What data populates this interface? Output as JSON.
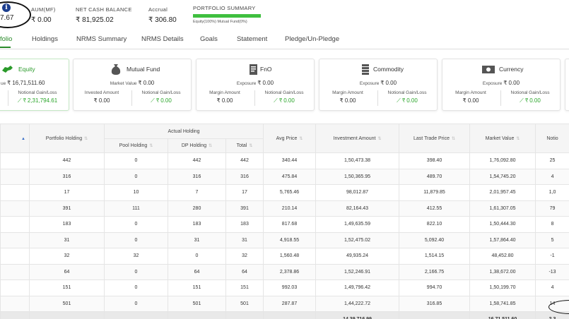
{
  "summary": {
    "aum_total": "7.67",
    "aum_mf_label": "AUM(MF)",
    "aum_mf_value": "₹ 0.00",
    "net_cash_label": "NET CASH BALANCE",
    "net_cash_value": "₹ 81,925.02",
    "accrual_label": "Accrual",
    "accrual_value": "₹ 306.80",
    "portfolio_summary_label": "PORTFOLIO SUMMARY",
    "portfolio_legend": "Equity(100%)   Mutual Fund(0%)",
    "equity_share_percent": 100,
    "accent_color": "#3fbf3f"
  },
  "tabs": [
    {
      "label": "folio"
    },
    {
      "label": "Holdings"
    },
    {
      "label": "NRMS Summary"
    },
    {
      "label": "NRMS Details"
    },
    {
      "label": "Goals"
    },
    {
      "label": "Statement"
    },
    {
      "label": "Pledge/Un-Pledge"
    }
  ],
  "cards": {
    "equity": {
      "title": "Equity",
      "sub_label": "ue",
      "sub_value": "₹ 16,71,511.60",
      "notional_label": "Notional Gain/Loss",
      "notional_value": "₹ 2,31,794.61"
    },
    "mutual_fund": {
      "title": "Mutual Fund",
      "sub_label": "Market Value",
      "sub_value": "₹ 0.00",
      "left_label": "Invested Amount",
      "left_value": "₹ 0.00",
      "right_label": "Notional Gain/Loss",
      "right_value": "₹ 0.00"
    },
    "fno": {
      "title": "FnO",
      "sub_label": "Exposure",
      "sub_value": "₹ 0.00",
      "left_label": "Margin Amount",
      "left_value": "₹ 0.00",
      "right_label": "Notional Gain/Loss",
      "right_value": "₹ 0.00"
    },
    "commodity": {
      "title": "Commodity",
      "sub_label": "Exposure",
      "sub_value": "₹ 0.00",
      "left_label": "Margin Amount",
      "left_value": "₹ 0.00",
      "right_label": "Notional Gain/Loss",
      "right_value": "₹ 0.00"
    },
    "currency": {
      "title": "Currency",
      "sub_label": "Exposure",
      "sub_value": "₹ 0.00",
      "left_label": "Margin Amount",
      "left_value": "₹ 0.00",
      "right_label": "Notional Gain/Loss",
      "right_value": "₹ 0.00"
    }
  },
  "table": {
    "headers": {
      "portfolio_holding": "Portfolio Holding",
      "actual_holding": "Actual Holding",
      "pool_holding": "Pool Holding",
      "dp_holding": "DP Holding",
      "total": "Total",
      "avg_price": "Avg Price",
      "investment_amount": "Investment Amount",
      "last_trade_price": "Last Trade Price",
      "market_value": "Market Value",
      "notional": "Notio"
    },
    "rows": [
      {
        "portfolio": "442",
        "pool": "0",
        "dp": "442",
        "total": "442",
        "avg": "340.44",
        "invest": "1,50,473.38",
        "ltp": "398.40",
        "mv": "1,76,092.80",
        "notional": "25"
      },
      {
        "portfolio": "316",
        "pool": "0",
        "dp": "316",
        "total": "316",
        "avg": "475.84",
        "invest": "1,50,365.95",
        "ltp": "489.70",
        "mv": "1,54,745.20",
        "notional": "4"
      },
      {
        "portfolio": "17",
        "pool": "10",
        "dp": "7",
        "total": "17",
        "avg": "5,765.46",
        "invest": "98,012.87",
        "ltp": "11,879.85",
        "mv": "2,01,957.45",
        "notional": "1,0"
      },
      {
        "portfolio": "391",
        "pool": "111",
        "dp": "280",
        "total": "391",
        "avg": "210.14",
        "invest": "82,164.43",
        "ltp": "412.55",
        "mv": "1,61,307.05",
        "notional": "79"
      },
      {
        "portfolio": "183",
        "pool": "0",
        "dp": "183",
        "total": "183",
        "avg": "817.68",
        "invest": "1,49,635.59",
        "ltp": "822.10",
        "mv": "1,50,444.30",
        "notional": "8"
      },
      {
        "portfolio": "31",
        "pool": "0",
        "dp": "31",
        "total": "31",
        "avg": "4,918.55",
        "invest": "1,52,475.02",
        "ltp": "5,092.40",
        "mv": "1,57,864.40",
        "notional": "5"
      },
      {
        "portfolio": "32",
        "pool": "32",
        "dp": "0",
        "total": "32",
        "avg": "1,560.48",
        "invest": "49,935.24",
        "ltp": "1,514.15",
        "mv": "48,452.80",
        "notional": "-1"
      },
      {
        "portfolio": "64",
        "pool": "0",
        "dp": "64",
        "total": "64",
        "avg": "2,378.86",
        "invest": "1,52,246.91",
        "ltp": "2,166.75",
        "mv": "1,38,672.00",
        "notional": "-13"
      },
      {
        "portfolio": "151",
        "pool": "0",
        "dp": "151",
        "total": "151",
        "avg": "992.03",
        "invest": "1,49,796.42",
        "ltp": "994.70",
        "mv": "1,50,199.70",
        "notional": "4"
      },
      {
        "portfolio": "501",
        "pool": "0",
        "dp": "501",
        "total": "501",
        "avg": "287.87",
        "invest": "1,44,222.72",
        "ltp": "316.85",
        "mv": "1,58,741.85",
        "notional": "14"
      }
    ],
    "footer": {
      "invest_total": "14,39,716.99",
      "mv_total": "16,71,511.60",
      "notional_total": "2,3"
    }
  }
}
